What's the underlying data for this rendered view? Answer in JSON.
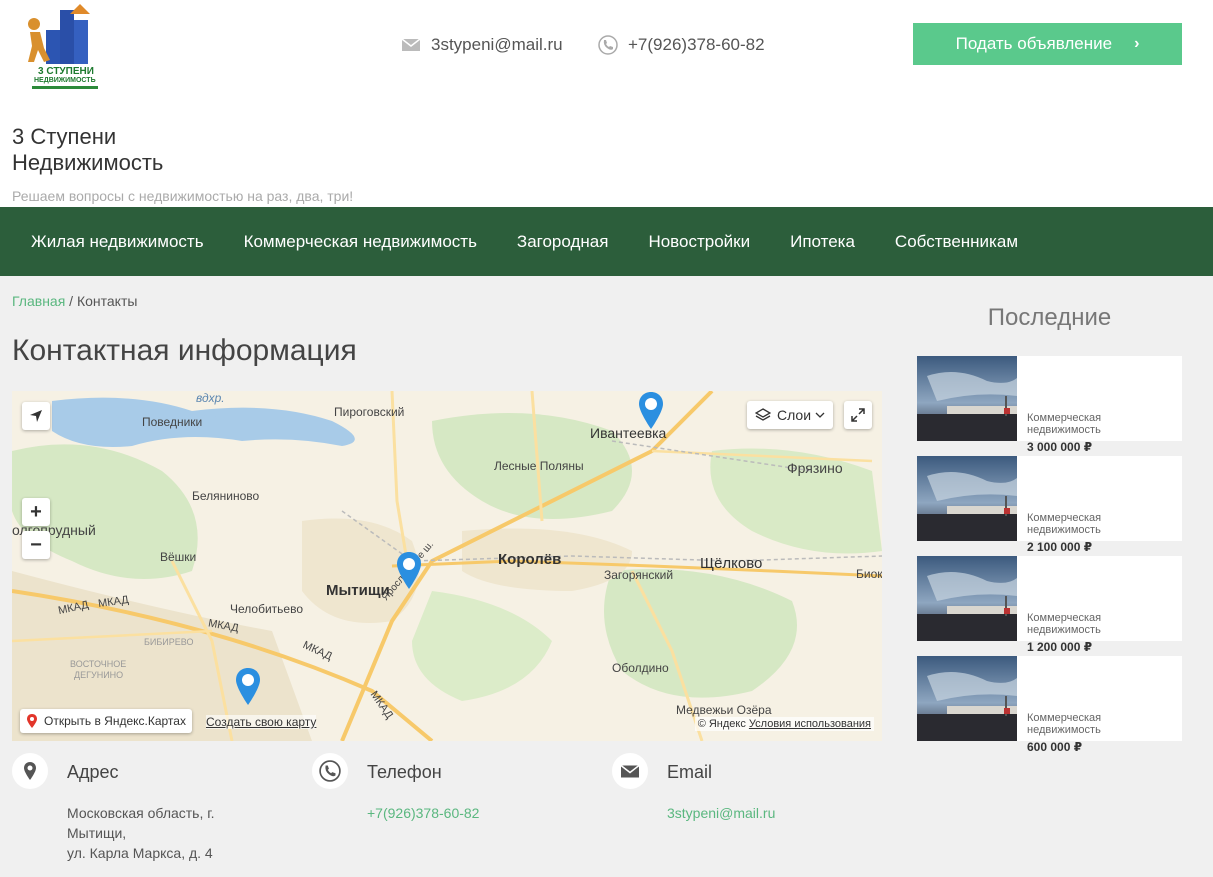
{
  "header": {
    "logo_text_1": "3 СТУПЕНИ",
    "logo_text_2": "НЕДВИЖИМОСТЬ",
    "email": "3stypeni@mail.ru",
    "phone": "+7(926)378-60-82",
    "cta_label": "Подать объявление",
    "site_name_1": "3 Ступени",
    "site_name_2": "Недвижимость",
    "tagline": "Решаем вопросы с недвижимостью на раз, два, три!"
  },
  "nav": {
    "items": [
      {
        "label": "Жилая недвижимость"
      },
      {
        "label": "Коммерческая недвижимость"
      },
      {
        "label": "Загородная"
      },
      {
        "label": "Новостройки"
      },
      {
        "label": "Ипотека"
      },
      {
        "label": "Собственникам"
      }
    ]
  },
  "breadcrumb": {
    "home": "Главная",
    "separator": " / ",
    "current": "Контакты"
  },
  "page_title": "Контактная информация",
  "map": {
    "layers_label": "Слои",
    "open_label": "Открыть в Яндекс.Картах",
    "create_label": "Создать свою карту",
    "copyright": "© Яндекс",
    "terms": "Условия использования",
    "places": {
      "vdhr": "вдхр.",
      "pirogovsky": "Пироговский",
      "ivanteevka": "Ивантеевка",
      "povedniki": "Поведники",
      "lesnye_polyany": "Лесные Поляны",
      "fryazino": "Фрязино",
      "belyaninovo": "Беляниново",
      "dolgoprudny": "олгопрудный",
      "korolev": "Королёв",
      "schelkovo": "Щёлково",
      "vyoshki": "Вёшки",
      "mytischi": "Мытищи",
      "zagoryansky": "Загорянский",
      "biok": "Биок",
      "chelobitevo": "Челобитьево",
      "mkad": "МКАД",
      "bibirevo": "БИБИРЕВО",
      "vost_degunino_1": "ВОСТОЧНОЕ",
      "vost_degunino_2": "ДЕГУНИНО",
      "yaroslavskoe": "Ярославское ш.",
      "oboldino": "Оболдино",
      "medvezhi": "Медвежьи Озёра"
    }
  },
  "contacts": {
    "address_title": "Адрес",
    "address_line1": "Московская область, г.",
    "address_line2": "Мытищи,",
    "address_line3": "ул. Карла Маркса, д. 4",
    "phone_title": "Телефон",
    "phone_value": "+7(926)378-60-82",
    "email_title": "Email",
    "email_value": "3stypeni@mail.ru"
  },
  "sidebar": {
    "title": "Последние",
    "cards": [
      {
        "category": "Коммерческая недвижимость",
        "price": "3 000 000 ₽"
      },
      {
        "category": "Коммерческая недвижимость",
        "price": "2 100 000 ₽"
      },
      {
        "category": "Коммерческая недвижимость",
        "price": "1 200 000 ₽"
      },
      {
        "category": "Коммерческая недвижимость",
        "price": "600 000 ₽"
      }
    ]
  },
  "colors": {
    "nav_bg": "#2c5e3b",
    "accent_green": "#5ac98c",
    "link_green": "#5ab77f",
    "map_pin": "#2b8fe0"
  }
}
